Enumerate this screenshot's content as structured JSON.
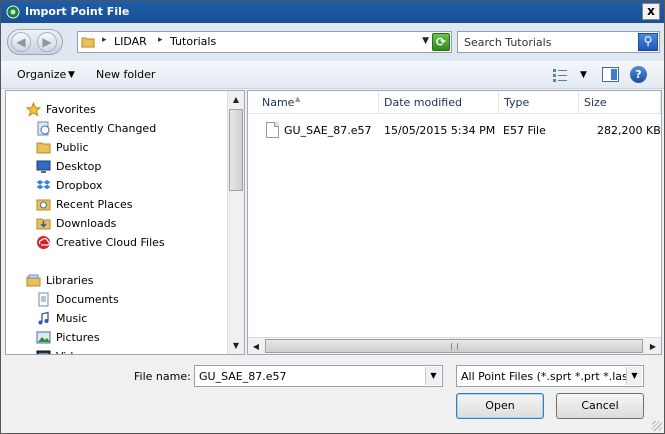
{
  "window": {
    "title": "Import Point File",
    "close_label": "x"
  },
  "address": {
    "segments": [
      "LIDAR",
      "Tutorials"
    ],
    "separator": "▸"
  },
  "search": {
    "placeholder": "Search Tutorials"
  },
  "toolbar": {
    "organize": "Organize",
    "new_folder": "New folder"
  },
  "sidebar": {
    "items": [
      {
        "label": "Favorites",
        "icon": "star-icon",
        "header": true
      },
      {
        "label": "Recently Changed",
        "icon": "recent-icon"
      },
      {
        "label": "Public",
        "icon": "folder-icon"
      },
      {
        "label": "Desktop",
        "icon": "desktop-icon"
      },
      {
        "label": "Dropbox",
        "icon": "dropbox-icon"
      },
      {
        "label": "Recent Places",
        "icon": "recent-places-icon"
      },
      {
        "label": "Downloads",
        "icon": "downloads-icon"
      },
      {
        "label": "Creative Cloud Files",
        "icon": "creative-cloud-icon"
      },
      {
        "label": "Libraries",
        "icon": "libraries-icon",
        "header": true
      },
      {
        "label": "Documents",
        "icon": "documents-icon"
      },
      {
        "label": "Music",
        "icon": "music-icon"
      },
      {
        "label": "Pictures",
        "icon": "pictures-icon"
      },
      {
        "label": "Videos",
        "icon": "videos-icon"
      }
    ]
  },
  "columns": {
    "name": "Name",
    "date": "Date modified",
    "type": "Type",
    "size": "Size"
  },
  "files": [
    {
      "name": "GU_SAE_87.e57",
      "date": "15/05/2015 5:34 PM",
      "type": "E57 File",
      "size": "282,200 KB"
    }
  ],
  "footer": {
    "file_name_label": "File name:",
    "file_name_value": "GU_SAE_87.e57",
    "file_type_value": "All Point Files (*.sprt *.prt *.las *",
    "open_label": "Open",
    "cancel_label": "Cancel"
  },
  "colors": {
    "titlebar": "#1f5dab",
    "accent": "#3d7fd0"
  }
}
